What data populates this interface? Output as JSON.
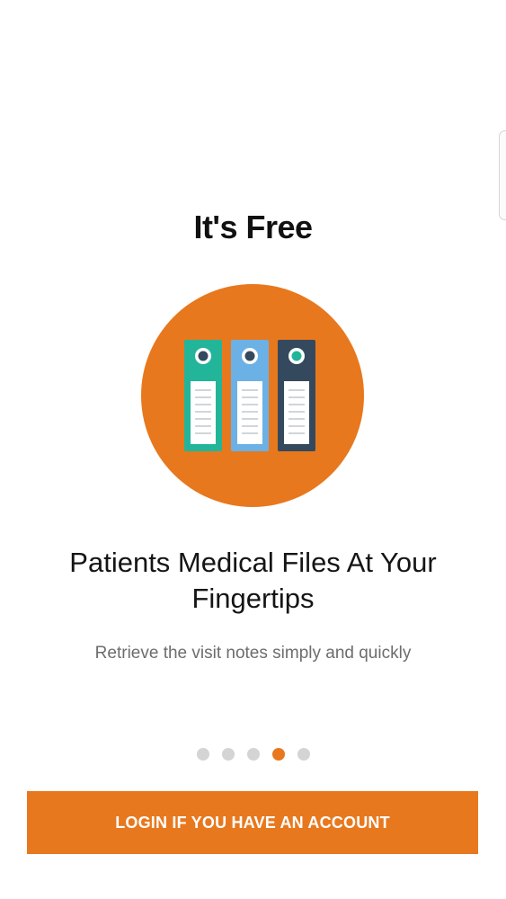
{
  "onboarding": {
    "title": "It's Free",
    "heading_line1": "Patients Medical Files At Your",
    "heading_line2": "Fingertips",
    "subtitle": "Retrieve the visit notes simply and quickly",
    "illustration_icon": "file-binders-icon",
    "page_count": 5,
    "active_page": 4
  },
  "actions": {
    "login_label": "LOGIN IF YOU HAVE AN ACCOUNT"
  },
  "colors": {
    "accent": "#e8781d",
    "binder_teal": "#22b59a",
    "binder_blue": "#6bb1e6",
    "binder_dark": "#34495e",
    "dot_inactive": "#d4d4d4"
  }
}
